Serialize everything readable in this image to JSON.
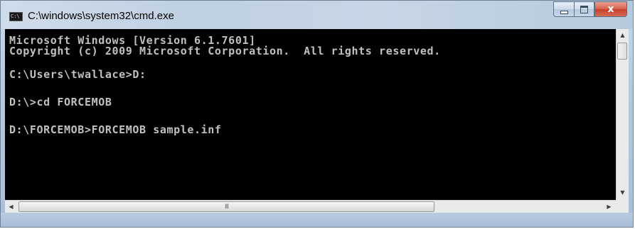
{
  "window": {
    "title": "C:\\windows\\system32\\cmd.exe",
    "icon": "cmd-icon",
    "icon_glyph": "C:\\"
  },
  "caption_buttons": {
    "minimize_icon": "minimize-icon",
    "maximize_icon": "maximize-icon",
    "close_icon": "close-icon",
    "close_glyph": "x"
  },
  "console": {
    "lines": [
      "Microsoft Windows [Version 6.1.7601]",
      "Copyright (c) 2009 Microsoft Corporation.  All rights reserved.",
      "C:\\Users\\twallace>D:",
      "D:\\>cd FORCEMOB",
      "D:\\FORCEMOB>FORCEMOB sample.inf"
    ]
  },
  "scrollbars": {
    "up_arrow": "▲",
    "down_arrow": "▼",
    "left_arrow": "◀",
    "right_arrow": "▶",
    "grip": "III"
  },
  "colors": {
    "console_background": "#000000",
    "console_text": "#c0c0c0",
    "close_button": "#c6402a",
    "frame": "#b4c8de"
  }
}
